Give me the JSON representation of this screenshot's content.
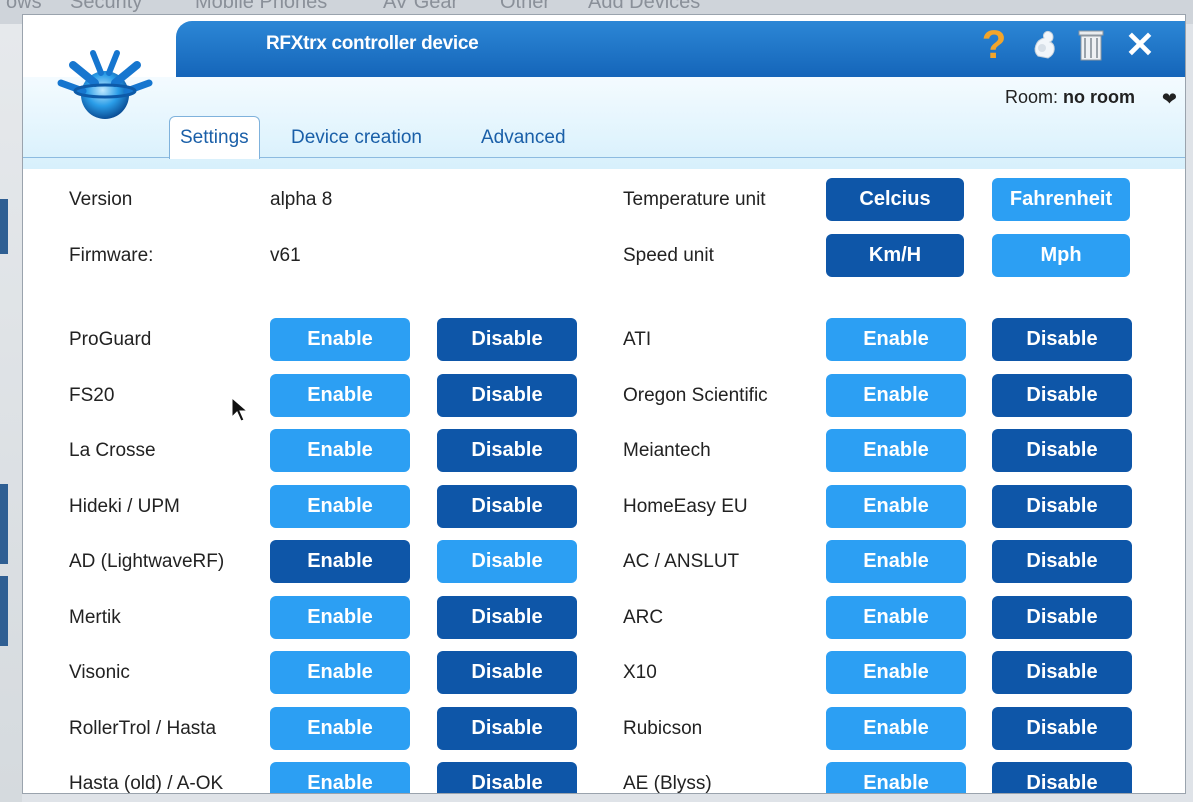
{
  "background": {
    "nav_items": [
      "ows",
      "Security",
      "Mobile Phones",
      "AV Gear",
      "Other",
      "Add Devices"
    ]
  },
  "dialog": {
    "title": "RFXtrx controller device",
    "room_label": "Room:",
    "room_value": "no room",
    "icons": [
      "help-icon",
      "plugin-icon",
      "trash-icon",
      "close-icon",
      "chevron-down-icon"
    ]
  },
  "tabs": [
    {
      "label": "Settings",
      "active": true
    },
    {
      "label": "Device creation",
      "active": false
    },
    {
      "label": "Advanced",
      "active": false
    }
  ],
  "settings": {
    "version_label": "Version",
    "version_value": "alpha 8",
    "firmware_label": "Firmware:",
    "firmware_value": "v61",
    "temperature_label": "Temperature unit",
    "temperature_options": [
      "Celcius",
      "Fahrenheit"
    ],
    "temperature_selected": "Celcius",
    "speed_label": "Speed unit",
    "speed_options": [
      "Km/H",
      "Mph"
    ],
    "speed_selected": "Km/H"
  },
  "buttons": {
    "enable": "Enable",
    "disable": "Disable"
  },
  "protocols_left": [
    {
      "name": "ProGuard",
      "state": "disabled"
    },
    {
      "name": "FS20",
      "state": "disabled"
    },
    {
      "name": "La Crosse",
      "state": "disabled"
    },
    {
      "name": "Hideki / UPM",
      "state": "disabled"
    },
    {
      "name": "AD (LightwaveRF)",
      "state": "enabled"
    },
    {
      "name": "Mertik",
      "state": "disabled"
    },
    {
      "name": "Visonic",
      "state": "disabled"
    },
    {
      "name": "RollerTrol / Hasta",
      "state": "disabled"
    },
    {
      "name": "Hasta (old) / A-OK",
      "state": "disabled"
    }
  ],
  "protocols_right": [
    {
      "name": "ATI",
      "state": "disabled"
    },
    {
      "name": "Oregon Scientific",
      "state": "disabled"
    },
    {
      "name": "Meiantech",
      "state": "disabled"
    },
    {
      "name": "HomeEasy EU",
      "state": "disabled"
    },
    {
      "name": "AC / ANSLUT",
      "state": "disabled"
    },
    {
      "name": "ARC",
      "state": "disabled"
    },
    {
      "name": "X10",
      "state": "disabled"
    },
    {
      "name": "Rubicson",
      "state": "disabled"
    },
    {
      "name": "AE (Blyss)",
      "state": "disabled"
    }
  ],
  "colors": {
    "selected_button": "#0e56a8",
    "unselected_button": "#2c9ff3",
    "titlebar": "#1f76c8",
    "help_icon": "#f3a52a"
  }
}
